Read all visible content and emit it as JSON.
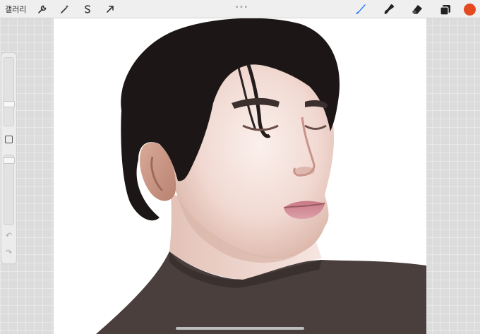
{
  "topbar": {
    "gallery_label": "갤러리",
    "left_tools": [
      {
        "name": "wrench-icon"
      },
      {
        "name": "magic-wand-icon"
      },
      {
        "name": "selection-s-icon"
      },
      {
        "name": "transform-arrow-icon"
      }
    ],
    "right_tools": [
      {
        "name": "brush-icon"
      },
      {
        "name": "smudge-icon"
      },
      {
        "name": "eraser-icon"
      },
      {
        "name": "layers-icon"
      }
    ],
    "current_color": "#e4491f",
    "accent_color": "#2b7cf6"
  },
  "canvas": {
    "background": "#ffffff",
    "artwork": "portrait-painting"
  },
  "sidebar": {
    "brush_size_level": 0.25,
    "opacity_level": 0.05
  }
}
